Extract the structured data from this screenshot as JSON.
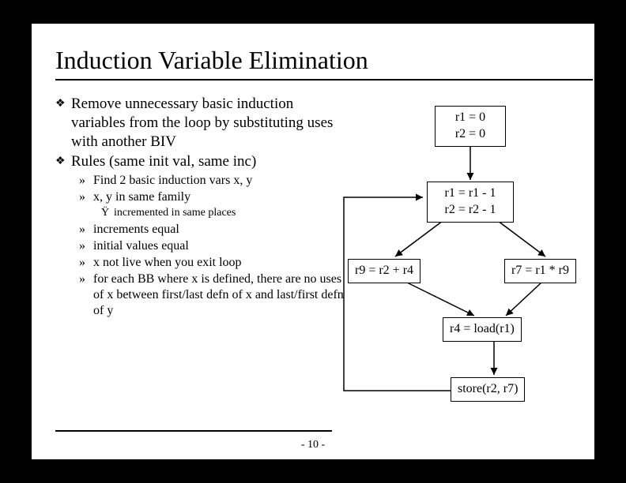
{
  "title": "Induction Variable Elimination",
  "bullets": {
    "b1": "Remove unnecessary basic induction variables from the loop by substituting uses with another BIV",
    "b2": "Rules (same init val, same inc)",
    "s1": "Find 2 basic induction vars x, y",
    "s2": "x, y in same family",
    "t1": "incremented in same places",
    "s3": "increments equal",
    "s4": "initial values equal",
    "s5": "x not live when you exit loop",
    "s6": "for each BB where x is defined, there are no uses of x between first/last defn of x and last/first defn of y"
  },
  "boxes": {
    "b1l1": "r1 = 0",
    "b1l2": "r2 = 0",
    "b2l1": "r1 = r1 - 1",
    "b2l2": "r2 = r2 - 1",
    "b3": "r9 = r2 + r4",
    "b4": "r7 = r1 * r9",
    "b5": "r4 = load(r1)",
    "b6": "store(r2, r7)"
  },
  "pagenum": "- 10 -"
}
